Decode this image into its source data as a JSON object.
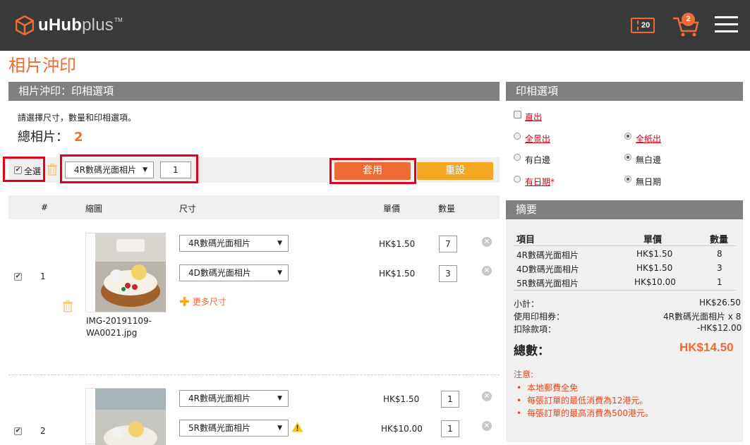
{
  "header": {
    "logo_u": "uHub",
    "logo_plus": "plus",
    "logo_tm": "TM",
    "coupon_count": "20",
    "cart_count": "2"
  },
  "page_title": "相片沖印",
  "left_panel": {
    "title": "相片沖印：印相選項",
    "hint": "請選擇尺寸，數量和印相選項。",
    "total_label": "總相片：",
    "total_value": "2",
    "select_all_label": "全選",
    "bulk_size": "4R數碼光面相片",
    "bulk_qty": "1",
    "apply_label": "套用",
    "reset_label": "重設",
    "columns": [
      "#",
      "縮圖",
      "尺寸",
      "單價",
      "數量"
    ],
    "rows": [
      {
        "index": "1",
        "filename_line1": "IMG-20191109-",
        "filename_line2": "WA0021.jpg",
        "items": [
          {
            "size": "4R數碼光面相片",
            "price": "HK$1.50",
            "qty": "7"
          },
          {
            "size": "4D數碼光面相片",
            "price": "HK$1.50",
            "qty": "3"
          }
        ],
        "more_sizes": "更多尺寸"
      },
      {
        "index": "2",
        "items": [
          {
            "size": "4R數碼光面相片",
            "price": "HK$1.50",
            "qty": "1"
          },
          {
            "size": "5R數碼光面相片",
            "price": "HK$10.00",
            "qty": "1"
          }
        ]
      }
    ]
  },
  "options_panel": {
    "title": "印相選項",
    "direct": "直出",
    "full_view": "全景出",
    "full_paper": "全紙出",
    "with_border": "有白邊",
    "no_border": "無白邊",
    "with_date": "有日期",
    "with_date_star": "*",
    "no_date": "無日期"
  },
  "summary": {
    "title": "摘要",
    "col_item": "項目",
    "col_price": "單價",
    "col_qty": "數量",
    "rows": [
      {
        "item": "4R數碼光面相片",
        "price": "HK$1.50",
        "qty": "8"
      },
      {
        "item": "4D數碼光面相片",
        "price": "HK$1.50",
        "qty": "3"
      },
      {
        "item": "5R數碼光面相片",
        "price": "HK$10.00",
        "qty": "1"
      }
    ],
    "subtotal_label": "小計：",
    "subtotal_value": "HK$26.50",
    "coupon_label": "使用印相券：",
    "coupon_value": "4R數碼光面相片 x 8",
    "deduct_label": "扣除款項：",
    "deduct_value": "-HK$12.00",
    "total_label": "總數：",
    "total_value": "HK$14.50"
  },
  "notes": {
    "title": "注意:",
    "items": [
      "本地郵費全免",
      "每張訂單的最低消費為12港元。",
      "每張訂單的最高消費為500港元。"
    ]
  },
  "colors": {
    "accent": "#f06a33",
    "reset": "#f5a623",
    "highlight": "#e0001a",
    "panel_header": "#808080"
  }
}
